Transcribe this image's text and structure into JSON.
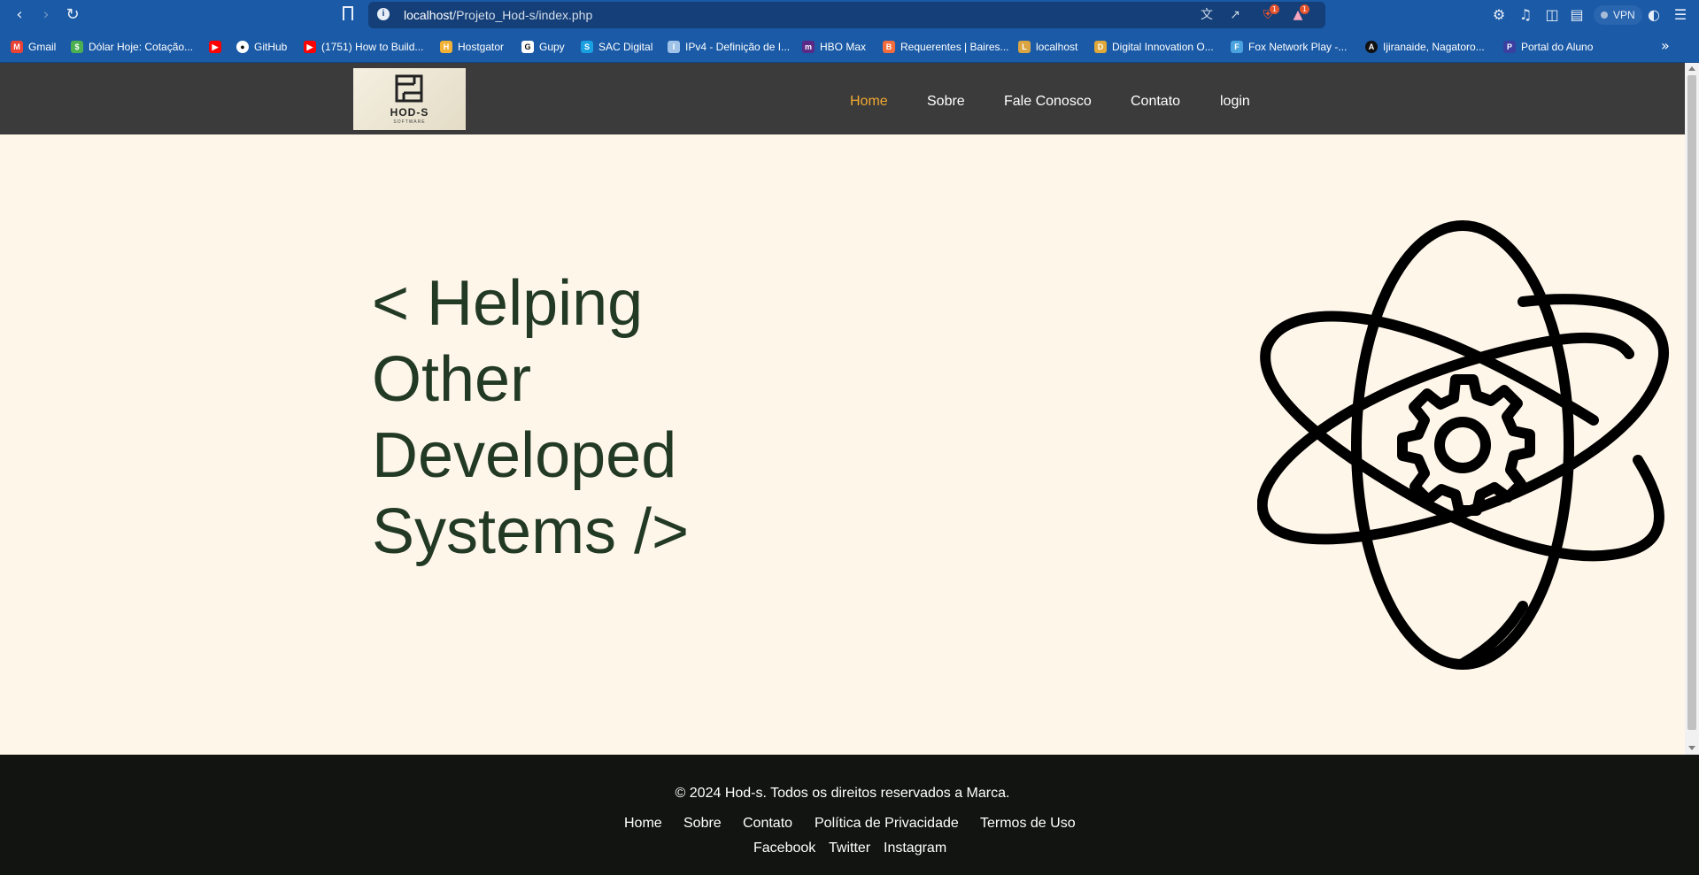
{
  "browser": {
    "url_host": "localhost",
    "url_path": "/Projeto_Hod-s/index.php",
    "vpn_label": "VPN",
    "badges": {
      "brave": "1",
      "rewards": "1"
    },
    "bookmarks": [
      {
        "label": "Gmail",
        "icon": "gmail-icon",
        "color": "#ea4335"
      },
      {
        "label": "Dólar Hoje: Cotação...",
        "icon": "dollar-icon",
        "color": "#4caf50"
      },
      {
        "label": "",
        "icon": "youtube-icon",
        "color": "#ff0000"
      },
      {
        "label": "GitHub",
        "icon": "github-icon",
        "color": "#ffffff"
      },
      {
        "label": "(1751) How to Build...",
        "icon": "youtube-icon",
        "color": "#ff0000"
      },
      {
        "label": "Hostgator",
        "icon": "hostgator-icon",
        "color": "#f2b134"
      },
      {
        "label": "Gupy",
        "icon": "gupy-icon",
        "color": "#ffffff"
      },
      {
        "label": "SAC Digital",
        "icon": "sac-icon",
        "color": "#1aa0e0"
      },
      {
        "label": "IPv4 - Definição de I...",
        "icon": "ipv4-icon",
        "color": "#9fc2e8"
      },
      {
        "label": "HBO Max",
        "icon": "hbo-icon",
        "color": "#5b2a86"
      },
      {
        "label": "Requerentes | Baires...",
        "icon": "baires-icon",
        "color": "#f46b3c"
      },
      {
        "label": "localhost",
        "icon": "localhost-icon",
        "color": "#d9a441"
      },
      {
        "label": "Digital Innovation O...",
        "icon": "dio-icon",
        "color": "#e0a83a"
      },
      {
        "label": "Fox Network Play -...",
        "icon": "fox-icon",
        "color": "#4aa3df"
      },
      {
        "label": "Ijiranaide, Nagatoro...",
        "icon": "anime-icon",
        "color": "#111111"
      },
      {
        "label": "Portal do Aluno",
        "icon": "portal-icon",
        "color": "#3a3fa0"
      }
    ]
  },
  "site": {
    "logo_text": "HOD-S",
    "logo_sub": "SOFTWARE",
    "nav": [
      {
        "label": "Home",
        "active": true
      },
      {
        "label": "Sobre",
        "active": false
      },
      {
        "label": "Fale Conosco",
        "active": false
      },
      {
        "label": "Contato",
        "active": false
      },
      {
        "label": "login",
        "active": false
      }
    ],
    "hero": {
      "line1": "< Helping",
      "line2": "Other",
      "line3": "Developed",
      "line4": "Systems />"
    },
    "footer": {
      "copyright": "© 2024 Hod-s. Todos os direitos reservados a Marca.",
      "links": [
        "Home",
        "Sobre",
        "Contato",
        "Política de Privacidade",
        "Termos de Uso"
      ],
      "social": [
        "Facebook",
        "Twitter",
        "Instagram"
      ]
    },
    "colors": {
      "header_bg": "#3b3b3b",
      "active_nav": "#f0a830",
      "hero_bg": "#fff6ea",
      "hero_text": "#223a24",
      "footer_bg": "#121412"
    }
  }
}
